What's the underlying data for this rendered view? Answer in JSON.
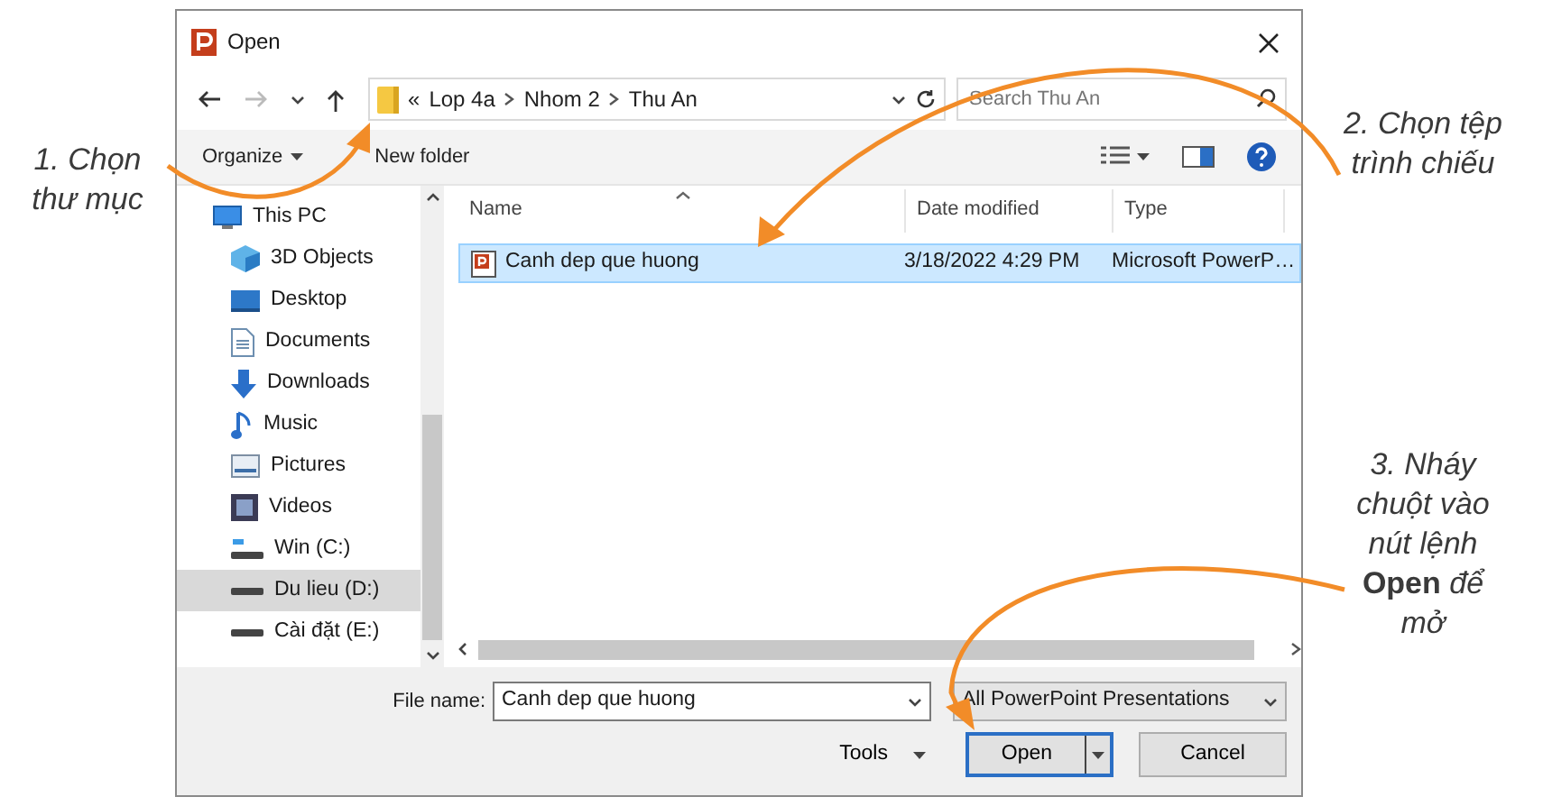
{
  "window": {
    "title": "Open"
  },
  "address": {
    "overflow": "«",
    "crumbs": [
      "Lop 4a",
      "Nhom 2",
      "Thu An"
    ]
  },
  "search": {
    "placeholder": "Search Thu An"
  },
  "toolbar": [
    {
      "label": "Organize",
      "dropdown": true
    },
    {
      "label": "New folder",
      "dropdown": false
    }
  ],
  "sidebar": {
    "items": [
      {
        "label": "This PC",
        "kind": "computer",
        "selected": false,
        "children": [
          {
            "label": "3D Objects",
            "kind": "objects",
            "selected": false
          },
          {
            "label": "Desktop",
            "kind": "desktop",
            "selected": false
          },
          {
            "label": "Documents",
            "kind": "documents",
            "selected": false
          },
          {
            "label": "Downloads",
            "kind": "downloads",
            "selected": false
          },
          {
            "label": "Music",
            "kind": "music",
            "selected": false
          },
          {
            "label": "Pictures",
            "kind": "pictures",
            "selected": false
          },
          {
            "label": "Videos",
            "kind": "videos",
            "selected": false
          },
          {
            "label": "Win (C:)",
            "kind": "system-drive",
            "selected": false
          },
          {
            "label": "Du lieu (D:)",
            "kind": "drive",
            "selected": true
          },
          {
            "label": "Cài đặt (E:)",
            "kind": "drive",
            "selected": false
          }
        ]
      }
    ]
  },
  "table": {
    "columns": [
      {
        "label": "Name",
        "sorted": true
      },
      {
        "label": "Date modified",
        "sorted": false
      },
      {
        "label": "Type",
        "sorted": false
      }
    ],
    "rows": [
      {
        "cells": [
          "Canh dep que huong",
          "3/18/2022 4:29 PM",
          "Microsoft PowerP…"
        ],
        "selected": true
      }
    ]
  },
  "footer": {
    "file_name_label": "File name:",
    "file_name": "Canh dep que huong",
    "file_type": "All PowerPoint Presentations",
    "tools": "Tools",
    "open": "Open",
    "cancel": "Cancel"
  },
  "annotations": [
    {
      "lines": [
        "1. Chọn",
        "thư mục"
      ]
    },
    {
      "lines": [
        "2. Chọn tệp",
        "trình chiếu"
      ]
    },
    {
      "lines": [
        "3. Nháy",
        "chuột vào",
        "nút lệnh",
        "**Open** để",
        "mở"
      ]
    }
  ]
}
